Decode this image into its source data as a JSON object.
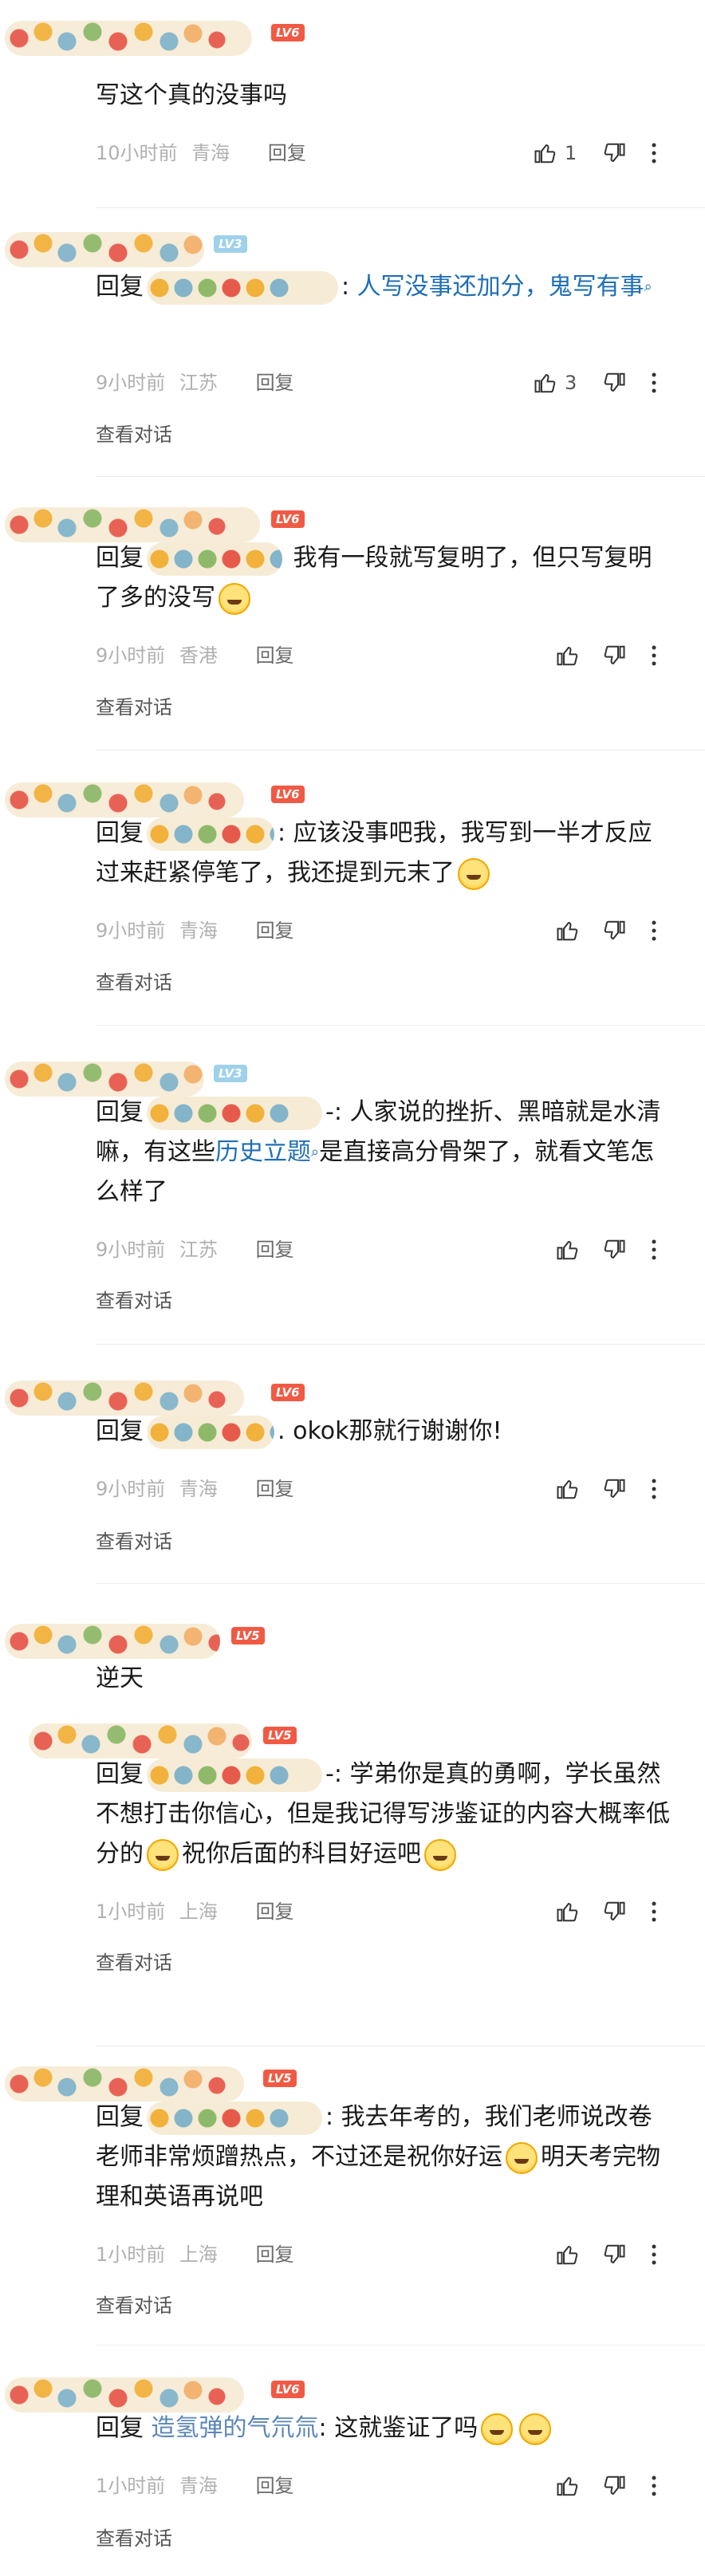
{
  "comments": [
    {
      "badge": "LV6",
      "text": "写这个真的没事吗",
      "time": "10小时前",
      "loc": "青海",
      "reply": "回复",
      "likes": "1"
    },
    {
      "badge": "LV3",
      "prefix": "回复",
      "sep": ":",
      "text": "人写没事还加分，鬼写有事",
      "time": "9小时前",
      "loc": "江苏",
      "reply": "回复",
      "likes": "3",
      "view": "查看对话"
    },
    {
      "badge": "LV6",
      "prefix": "回复",
      "text": "我有一段就写复明了，但只写复明了多的没写",
      "time": "9小时前",
      "loc": "香港",
      "reply": "回复",
      "view": "查看对话"
    },
    {
      "badge": "LV6",
      "prefix": "回复",
      "sep": ":",
      "text": "应该没事吧我，我写到一半才反应过来赶紧停笔了，我还提到元末了",
      "time": "9小时前",
      "loc": "青海",
      "reply": "回复",
      "view": "查看对话"
    },
    {
      "badge": "LV3",
      "prefix": "回复",
      "sep": "-:",
      "text_a": "人家说的挫折、黑暗就是水清嘛，有这些",
      "link": "历史立题",
      "text_b": "是直接高分骨架了，就看文笔怎么样了",
      "time": "9小时前",
      "loc": "江苏",
      "reply": "回复",
      "view": "查看对话"
    },
    {
      "badge": "LV6",
      "prefix": "回复",
      "sep": ".",
      "text": "okok那就行谢谢你!",
      "time": "9小时前",
      "loc": "青海",
      "reply": "回复",
      "view": "查看对话"
    },
    {
      "badge": "LV5",
      "text": "逆天"
    },
    {
      "badge": "LV5",
      "prefix": "回复",
      "sep": "-:",
      "text_a": "学弟你是真的勇啊，学长虽然不想打击你信心，但是我记得写涉鉴证的内容大概率低分的",
      "text_b": "祝你后面的科目好运吧",
      "time": "1小时前",
      "loc": "上海",
      "reply": "回复",
      "view": "查看对话"
    },
    {
      "badge": "LV5",
      "prefix": "回复",
      "sep": ":",
      "text_a": "我去年考的，我们老师说改卷老师非常烦蹭热点，不过还是祝你好运",
      "text_b": "明天考完物理和英语再说吧",
      "time": "1小时前",
      "loc": "上海",
      "reply": "回复",
      "view": "查看对话"
    },
    {
      "badge": "LV6",
      "prefix": "回复",
      "user": "造氢弹的气氘氚",
      "sep": ":",
      "text": "这就鉴证了吗",
      "time": "1小时前",
      "loc": "青海",
      "reply": "回复",
      "view": "查看对话"
    }
  ]
}
